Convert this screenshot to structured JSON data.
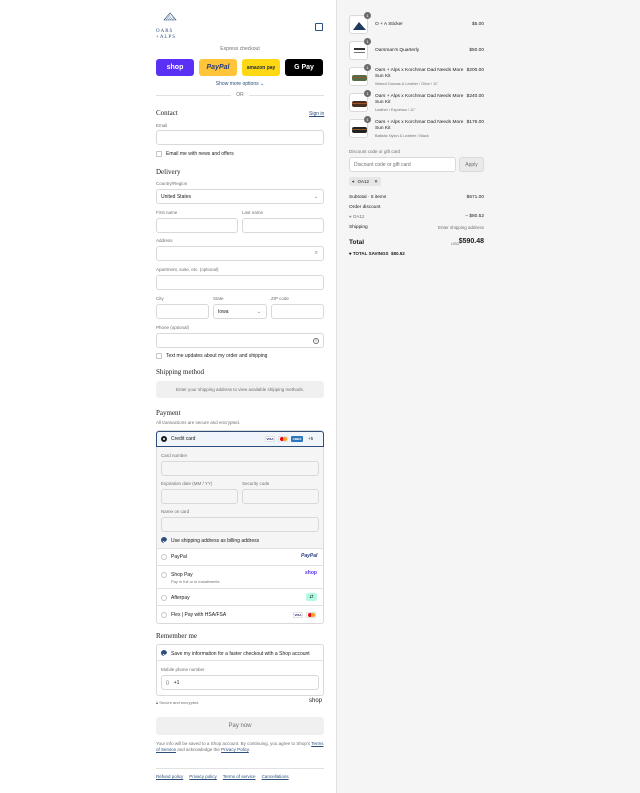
{
  "brand": {
    "line1": "OARS",
    "line2": "+ALPS"
  },
  "express": {
    "title": "Express checkout",
    "buttons": {
      "shop": "shop",
      "paypal": "PayPal",
      "amazon": "amazon pay",
      "gpay": "G Pay"
    },
    "more": "Show more options",
    "or": "OR"
  },
  "contact": {
    "title": "Contact",
    "signin": "Sign in",
    "email_label": "Email",
    "email_value": "",
    "news": "Email me with news and offers"
  },
  "delivery": {
    "title": "Delivery",
    "country_label": "Country/Region",
    "country": "United States",
    "first_label": "First name",
    "last_label": "Last name",
    "address_label": "Address",
    "apt_label": "Apartment, suite, etc. (optional)",
    "city_label": "City",
    "state_label": "State",
    "state": "Iowa",
    "zip_label": "ZIP code",
    "phone_label": "Phone (optional)",
    "text_me": "Text me updates about my order and shipping"
  },
  "shipping": {
    "title": "Shipping method",
    "notice": "Enter your shipping address to view available shipping methods."
  },
  "payment": {
    "title": "Payment",
    "subtitle": "All transactions are secure and encrypted.",
    "credit_card": "Credit card",
    "more_cards": "+5",
    "card_number": "Card number",
    "expiration": "Expiration date (MM / YY)",
    "security": "Security code",
    "name_on_card": "Name on card",
    "billing_same": "Use shipping address as billing address",
    "paypal": "PayPal",
    "paypal_logo": "PayPal",
    "shop_pay": "Shop Pay",
    "shop_pay_sub": "Pay in full or in installments",
    "shop_logo": "shop",
    "afterpay": "Afterpay",
    "flex": "Flex | Pay with HSA/FSA"
  },
  "remember": {
    "title": "Remember me",
    "save_info": "Save my information for a faster checkout with a Shop account",
    "mobile_label": "Mobile phone number",
    "mobile_prefix": "+1",
    "secure": "Secure and encrypted",
    "shop_logo": "shop"
  },
  "pay_now": "Pay now",
  "footer_note": {
    "before": "Your info will be saved to a Shop account. By continuing, you agree to Shop's ",
    "tos": "Terms of Service",
    "middle": " and acknowledge the ",
    "privacy": "Privacy Policy",
    "end": "."
  },
  "footer_links": [
    "Refund policy",
    "Privacy policy",
    "Terms of service",
    "Cancellations"
  ],
  "cart": {
    "items": [
      {
        "qty": "1",
        "name": "O + A Sticker",
        "variant": "",
        "price": "$5.00"
      },
      {
        "qty": "1",
        "name": "Oarsman's Quarterly",
        "variant": "",
        "price": "$50.00"
      },
      {
        "qty": "1",
        "name": "Oars + Alps x Korchmar Dad Needs More Sun Kit",
        "variant": "Waxed Canvas & Leather / Olive / 11\"",
        "price": "$200.00"
      },
      {
        "qty": "1",
        "name": "Oars + Alps x Korchmar Dad Needs More Sun Kit",
        "variant": "Leather / Espresso / 11\"",
        "price": "$240.00"
      },
      {
        "qty": "1",
        "name": "Oars + Alps x Korchmar Dad Needs More Sun Kit",
        "variant": "Ballistic Nylon & Leather / Black",
        "price": "$176.00"
      }
    ],
    "discount_label": "Discount code or gift card",
    "discount_placeholder": "Discount code or gift card",
    "apply": "Apply",
    "code": "OA12",
    "subtotal_label": "Subtotal · 5 items",
    "subtotal": "$671.00",
    "order_discount_label": "Order discount",
    "discount_code": "OA12",
    "discount_amount": "– $80.52",
    "shipping_label": "Shipping",
    "shipping_value": "Enter shipping address",
    "total_label": "Total",
    "currency": "USD",
    "total": "$590.48",
    "savings_label": "TOTAL SAVINGS",
    "savings": "$80.52"
  }
}
